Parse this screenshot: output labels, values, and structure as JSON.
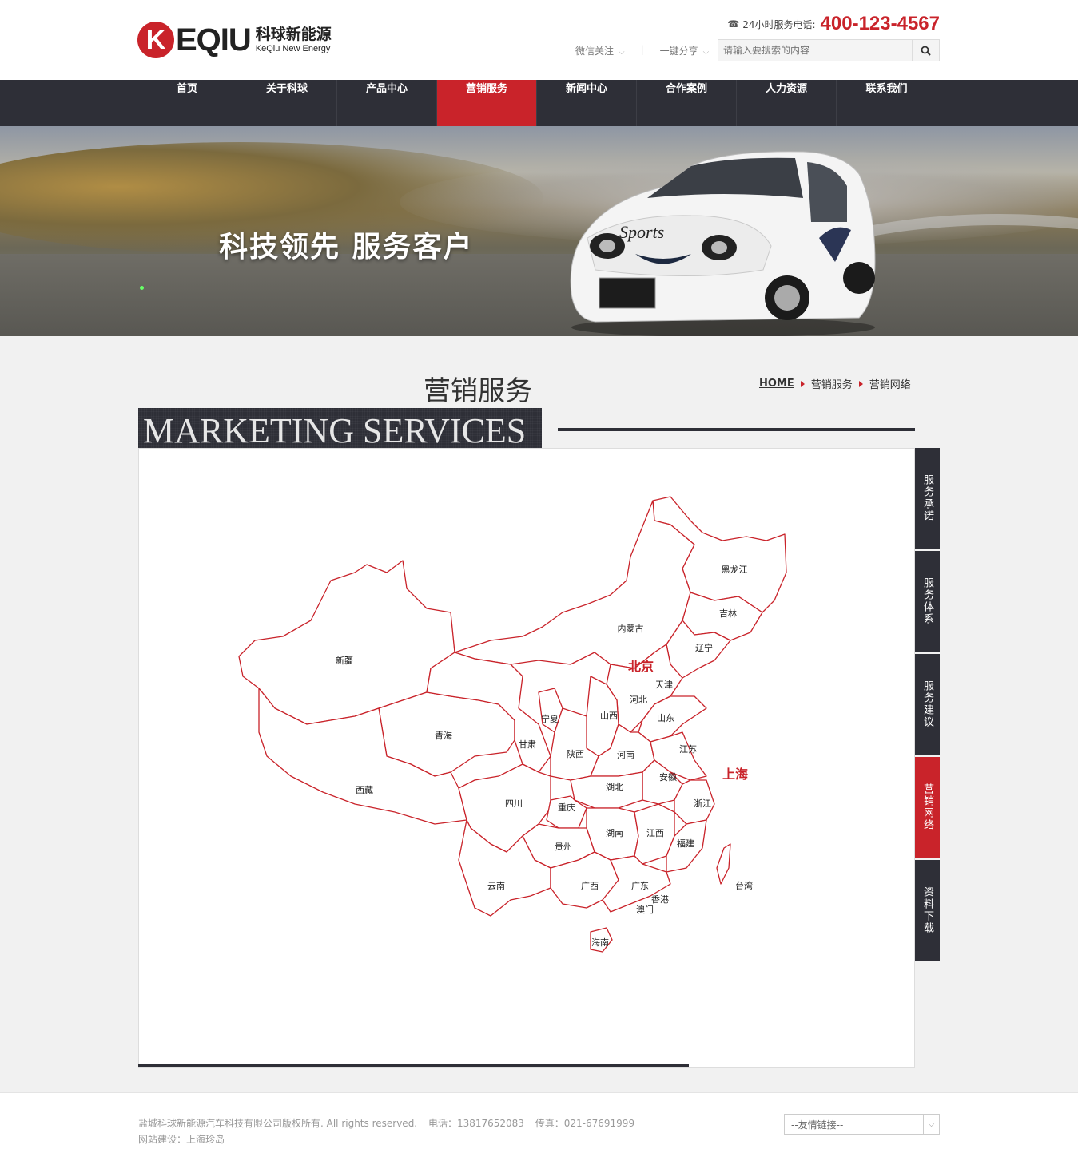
{
  "header": {
    "logo_letter": "K",
    "logo_word": "EQIU",
    "logo_cn": "科球新能源",
    "logo_en": "KeQiu New Energy",
    "hotline_label": "24小时服务电话:",
    "hotline_number": "400-123-4567",
    "wechat_label": "微信关注",
    "share_label": "一键分享",
    "search_placeholder": "请输入要搜索的内容"
  },
  "nav": {
    "items": [
      {
        "label": "首页"
      },
      {
        "label": "关于科球"
      },
      {
        "label": "产品中心"
      },
      {
        "label": "营销服务"
      },
      {
        "label": "新闻中心"
      },
      {
        "label": "合作案例"
      },
      {
        "label": "人力资源"
      },
      {
        "label": "联系我们"
      }
    ],
    "active_index": 3
  },
  "banner": {
    "slogan": "科技领先  服务客户",
    "car_label": "Sports"
  },
  "content": {
    "title_cn": "营销服务",
    "title_en": "MARKETING SERVICES",
    "breadcrumb": [
      "HOME",
      "营销服务",
      "营销网络"
    ]
  },
  "map": {
    "provinces": [
      "黑龙江",
      "吉林",
      "辽宁",
      "内蒙古",
      "北京",
      "天津",
      "河北",
      "山西",
      "山东",
      "新疆",
      "宁夏",
      "青海",
      "甘肃",
      "陕西",
      "河南",
      "江苏",
      "上海",
      "安徽",
      "湖北",
      "西藏",
      "四川",
      "重庆",
      "浙江",
      "湖南",
      "江西",
      "福建",
      "贵州",
      "台湾",
      "云南",
      "广西",
      "广东",
      "香港",
      "澳门",
      "海南"
    ],
    "highlight_color": "#c9232a"
  },
  "side_tabs": [
    {
      "label": "服务承诺"
    },
    {
      "label": "服务体系"
    },
    {
      "label": "服务建议"
    },
    {
      "label": "营销网络"
    },
    {
      "label": "资料下载"
    }
  ],
  "footer": {
    "copyright": "盐城科球新能源汽车科技有限公司版权所有. All rights reserved.",
    "phone": "电话：13817652083",
    "fax": "传真：021-67691999",
    "builder": "网站建设：上海珍岛",
    "friend_links": "--友情链接--"
  },
  "colors": {
    "brand_red": "#c9232a",
    "nav_dark": "#2e2f37"
  }
}
